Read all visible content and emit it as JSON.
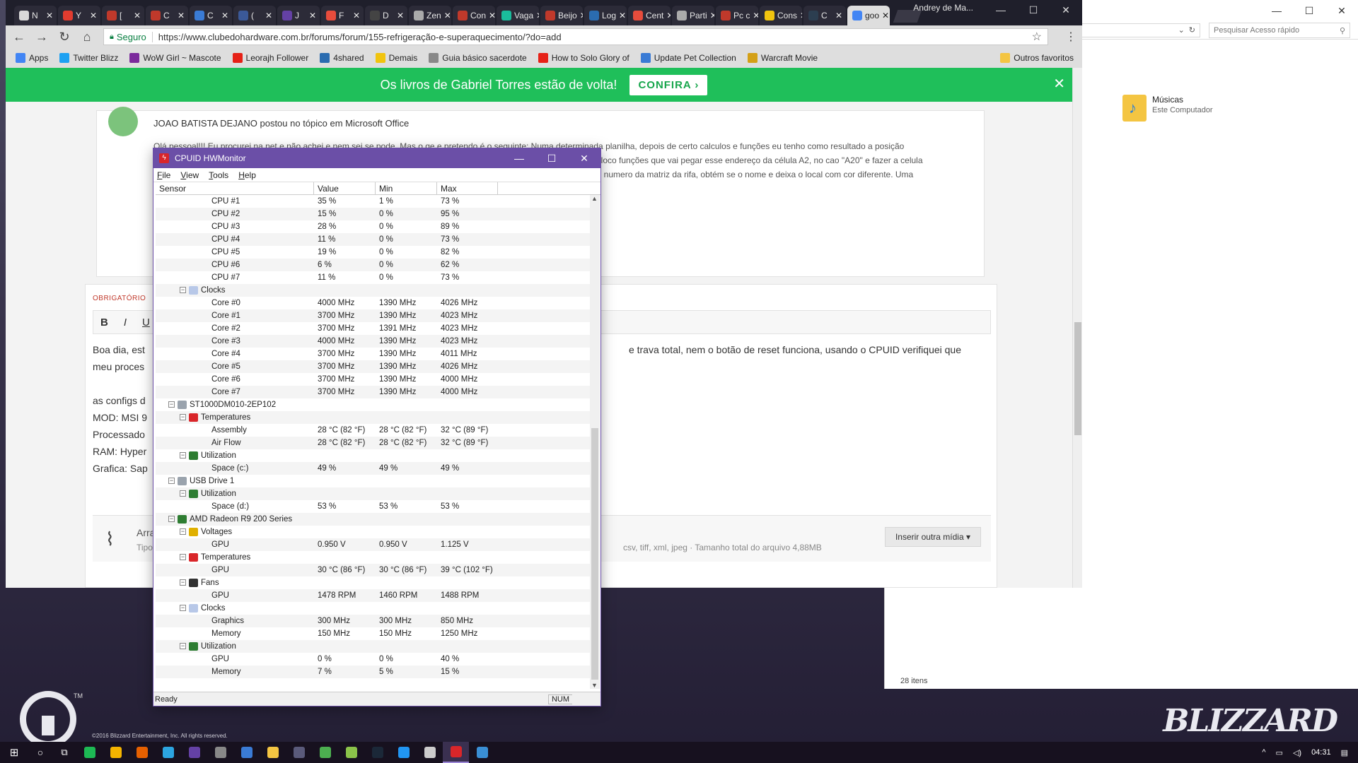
{
  "wallpaper": {
    "tm": "TM",
    "copyright": "©2016 Blizzard Entertainment, Inc. All rights reserved.",
    "blizzard": "BLIZZARD"
  },
  "explorer": {
    "search_placeholder": "Pesquisar Acesso rápido",
    "item_name": "Músicas",
    "item_sub": "Este Computador",
    "count": "28 itens"
  },
  "chrome": {
    "user": "Andrey de Ma...",
    "tabs": [
      {
        "label": "N",
        "color": "#d9d9d9"
      },
      {
        "label": "Y",
        "color": "#e23c2f"
      },
      {
        "label": "[",
        "color": "#c0392b"
      },
      {
        "label": "C",
        "color": "#c0392b"
      },
      {
        "label": "C",
        "color": "#3a7bd5"
      },
      {
        "label": "(",
        "color": "#3b5998"
      },
      {
        "label": "J",
        "color": "#6441a5"
      },
      {
        "label": "F",
        "color": "#e74c3c"
      },
      {
        "label": "D",
        "color": "#444444"
      },
      {
        "label": "Zen",
        "color": "#aaaaaa"
      },
      {
        "label": "Con",
        "color": "#c0392b"
      },
      {
        "label": "Vaga",
        "color": "#1abc9c"
      },
      {
        "label": "Beijo",
        "color": "#c0392b"
      },
      {
        "label": "Log",
        "color": "#2b6cb0"
      },
      {
        "label": "Cent",
        "color": "#e74c3c"
      },
      {
        "label": "Parti",
        "color": "#aaaaaa"
      },
      {
        "label": "Pc c",
        "color": "#c0392b"
      },
      {
        "label": "Cons",
        "color": "#f1c40f"
      },
      {
        "label": "C",
        "color": "#2c3e50"
      },
      {
        "label": "goo",
        "color": "#4285f4"
      }
    ],
    "secure_label": "Seguro",
    "url": "https://www.clubedohardware.com.br/forums/forum/155-refrigeração-e-superaquecimento/?do=add",
    "bookmarks": [
      {
        "label": "Apps",
        "color": "#4285f4"
      },
      {
        "label": "Twitter Blizz",
        "color": "#1da1f2"
      },
      {
        "label": "WoW Girl ~ Mascote",
        "color": "#7b2b9c"
      },
      {
        "label": "Leorajh Follower",
        "color": "#e62117"
      },
      {
        "label": "4shared",
        "color": "#2b6cb0"
      },
      {
        "label": "Demais",
        "color": "#f1c40f"
      },
      {
        "label": "Guia básico sacerdote",
        "color": "#888888"
      },
      {
        "label": "How to Solo Glory of",
        "color": "#e62117"
      },
      {
        "label": "Update Pet Collection",
        "color": "#3a7bd5"
      },
      {
        "label": "Warcraft Movie",
        "color": "#d4a017"
      }
    ],
    "other_bookmarks": "Outros favoritos"
  },
  "forum": {
    "promo_text": "Os livros de Gabriel Torres estão de volta!",
    "promo_button": "CONFIRA ›",
    "comment_head": "JOAO BATISTA DEJANO postou no tópico em Microsoft Office",
    "comment_body_1": "Olá pessoal!!! Eu procurei na net e não achei e nem sei se pode. Mas o qe e pretendo é o seguinte: Numa determinada planilha, depois de certo calculos e funções eu tenho como resultado a posição",
    "comment_body_2": "coloco funções que vai pegar esse endereço da célula A2, no cao \"A20\" e fazer a celula",
    "comment_body_3": "do numero da matriz da rifa, obtém se o nome e deixa o local com cor diferente. Uma",
    "required": "OBRIGATÓRIO",
    "bold": "B",
    "italic": "I",
    "underline": "U",
    "editor_line1_left": "Boa dia, est",
    "editor_line1_right": "e trava total, nem o botão de reset funciona, usando o CPUID verifiquei que",
    "editor_line2": "meu proces",
    "editor_line3": "as configs d",
    "editor_line4": "MOD: MSI 9",
    "editor_line5": "Processado",
    "editor_line6": "RAM: Hyper",
    "editor_line7": "Grafica: Sap",
    "attach_label": "Arrast",
    "attach_types": "Tipo d",
    "attach_types_right": "csv, tiff, xml, jpeg · Tamanho total do arquivo 4,88MB",
    "insert_media": "Inserir outra mídia ▾"
  },
  "hwm": {
    "title": "CPUID HWMonitor",
    "menu": [
      "File",
      "View",
      "Tools",
      "Help"
    ],
    "headers": [
      "Sensor",
      "Value",
      "Min",
      "Max"
    ],
    "status": "Ready",
    "num": "NUM",
    "rows": [
      {
        "level": 3,
        "name": "CPU #1",
        "value": "35 %",
        "min": "1 %",
        "max": "73 %"
      },
      {
        "level": 3,
        "name": "CPU #2",
        "value": "15 %",
        "min": "0 %",
        "max": "95 %"
      },
      {
        "level": 3,
        "name": "CPU #3",
        "value": "28 %",
        "min": "0 %",
        "max": "89 %"
      },
      {
        "level": 3,
        "name": "CPU #4",
        "value": "11 %",
        "min": "0 %",
        "max": "73 %"
      },
      {
        "level": 3,
        "name": "CPU #5",
        "value": "19 %",
        "min": "0 %",
        "max": "82 %"
      },
      {
        "level": 3,
        "name": "CPU #6",
        "value": "6 %",
        "min": "0 %",
        "max": "62 %"
      },
      {
        "level": 3,
        "name": "CPU #7",
        "value": "11 %",
        "min": "0 %",
        "max": "73 %"
      },
      {
        "level": 2,
        "name": "Clocks",
        "icon": "clock",
        "value": "",
        "min": "",
        "max": ""
      },
      {
        "level": 3,
        "name": "Core #0",
        "value": "4000 MHz",
        "min": "1390 MHz",
        "max": "4026 MHz"
      },
      {
        "level": 3,
        "name": "Core #1",
        "value": "3700 MHz",
        "min": "1390 MHz",
        "max": "4023 MHz"
      },
      {
        "level": 3,
        "name": "Core #2",
        "value": "3700 MHz",
        "min": "1391 MHz",
        "max": "4023 MHz"
      },
      {
        "level": 3,
        "name": "Core #3",
        "value": "4000 MHz",
        "min": "1390 MHz",
        "max": "4023 MHz"
      },
      {
        "level": 3,
        "name": "Core #4",
        "value": "3700 MHz",
        "min": "1390 MHz",
        "max": "4011 MHz"
      },
      {
        "level": 3,
        "name": "Core #5",
        "value": "3700 MHz",
        "min": "1390 MHz",
        "max": "4026 MHz"
      },
      {
        "level": 3,
        "name": "Core #6",
        "value": "3700 MHz",
        "min": "1390 MHz",
        "max": "4000 MHz"
      },
      {
        "level": 3,
        "name": "Core #7",
        "value": "3700 MHz",
        "min": "1390 MHz",
        "max": "4000 MHz"
      },
      {
        "level": 1,
        "name": "ST1000DM010-2EP102",
        "icon": "disk",
        "value": "",
        "min": "",
        "max": ""
      },
      {
        "level": 2,
        "name": "Temperatures",
        "icon": "temp",
        "value": "",
        "min": "",
        "max": ""
      },
      {
        "level": 3,
        "name": "Assembly",
        "value": "28 °C  (82 °F)",
        "min": "28 °C  (82 °F)",
        "max": "32 °C  (89 °F)"
      },
      {
        "level": 3,
        "name": "Air Flow",
        "value": "28 °C  (82 °F)",
        "min": "28 °C  (82 °F)",
        "max": "32 °C  (89 °F)"
      },
      {
        "level": 2,
        "name": "Utilization",
        "icon": "util",
        "value": "",
        "min": "",
        "max": ""
      },
      {
        "level": 3,
        "name": "Space (c:)",
        "value": "49 %",
        "min": "49 %",
        "max": "49 %"
      },
      {
        "level": 1,
        "name": "USB Drive 1",
        "icon": "disk",
        "value": "",
        "min": "",
        "max": ""
      },
      {
        "level": 2,
        "name": "Utilization",
        "icon": "util",
        "value": "",
        "min": "",
        "max": ""
      },
      {
        "level": 3,
        "name": "Space (d:)",
        "value": "53 %",
        "min": "53 %",
        "max": "53 %"
      },
      {
        "level": 1,
        "name": "AMD Radeon R9 200 Series",
        "icon": "gpu",
        "value": "",
        "min": "",
        "max": ""
      },
      {
        "level": 2,
        "name": "Voltages",
        "icon": "volt",
        "value": "",
        "min": "",
        "max": ""
      },
      {
        "level": 3,
        "name": "GPU",
        "value": "0.950 V",
        "min": "0.950 V",
        "max": "1.125 V"
      },
      {
        "level": 2,
        "name": "Temperatures",
        "icon": "temp",
        "value": "",
        "min": "",
        "max": ""
      },
      {
        "level": 3,
        "name": "GPU",
        "value": "30 °C  (86 °F)",
        "min": "30 °C  (86 °F)",
        "max": "39 °C  (102 °F)"
      },
      {
        "level": 2,
        "name": "Fans",
        "icon": "fan",
        "value": "",
        "min": "",
        "max": ""
      },
      {
        "level": 3,
        "name": "GPU",
        "value": "1478 RPM",
        "min": "1460 RPM",
        "max": "1488 RPM"
      },
      {
        "level": 2,
        "name": "Clocks",
        "icon": "clock",
        "value": "",
        "min": "",
        "max": ""
      },
      {
        "level": 3,
        "name": "Graphics",
        "value": "300 MHz",
        "min": "300 MHz",
        "max": "850 MHz"
      },
      {
        "level": 3,
        "name": "Memory",
        "value": "150 MHz",
        "min": "150 MHz",
        "max": "1250 MHz"
      },
      {
        "level": 2,
        "name": "Utilization",
        "icon": "util",
        "value": "",
        "min": "",
        "max": ""
      },
      {
        "level": 3,
        "name": "GPU",
        "value": "0 %",
        "min": "0 %",
        "max": "40 %"
      },
      {
        "level": 3,
        "name": "Memory",
        "value": "7 %",
        "min": "5 %",
        "max": "15 %"
      }
    ]
  },
  "taskbar": {
    "apps": [
      {
        "name": "spotify",
        "color": "#1db954"
      },
      {
        "name": "chrome",
        "color": "#f4b400"
      },
      {
        "name": "firefox",
        "color": "#e66000"
      },
      {
        "name": "telegram",
        "color": "#2ca5e0"
      },
      {
        "name": "twitch",
        "color": "#6441a5"
      },
      {
        "name": "store",
        "color": "#888888"
      },
      {
        "name": "edge-tool",
        "color": "#3a7bd5"
      },
      {
        "name": "explorer",
        "color": "#f4c542"
      },
      {
        "name": "app-a",
        "color": "#5a5a7a"
      },
      {
        "name": "app-b",
        "color": "#4caf50"
      },
      {
        "name": "app-c",
        "color": "#8bc34a"
      },
      {
        "name": "steam",
        "color": "#1b2838"
      },
      {
        "name": "battle-net",
        "color": "#2196f3"
      },
      {
        "name": "epic",
        "color": "#cccccc"
      },
      {
        "name": "hwmonitor",
        "color": "#d9262a"
      },
      {
        "name": "cpuid",
        "color": "#3a8fd5"
      }
    ],
    "active_index": 14,
    "clock": "04:31"
  }
}
